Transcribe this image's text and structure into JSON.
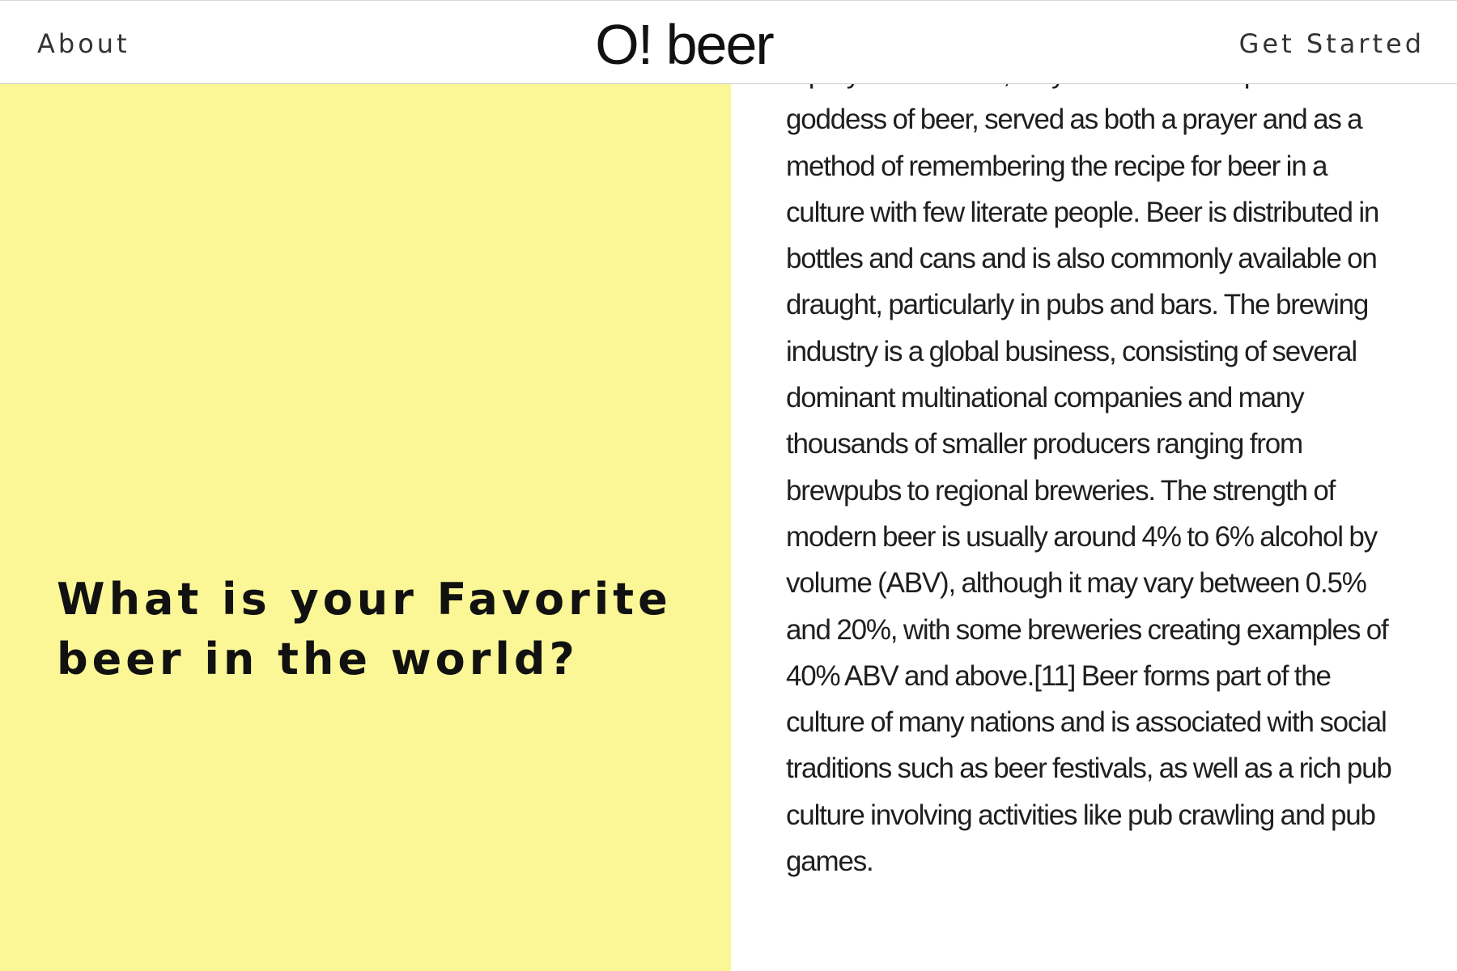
{
  "header": {
    "about_label": "About",
    "logo_text": "O! beer",
    "get_started_label": "Get Started"
  },
  "hero": {
    "headline_line1": "What is your Favorite",
    "headline_line2": "beer in the world?"
  },
  "article": {
    "body": "A prayer to Ninkasi, a hymn to the Mesopotamian goddess of beer, served as both a prayer and as a method of remembering the recipe for beer in a culture with few literate people. Beer is distributed in bottles and cans and is also commonly available on draught, particularly in pubs and bars. The brewing industry is a global business, consisting of several dominant multinational companies and many thousands of smaller producers ranging from brewpubs to regional breweries. The strength of modern beer is usually around 4% to 6% alcohol by volume (ABV), although it may vary between 0.5% and 20%, with some breweries creating examples of 40% ABV and above.[11] Beer forms part of the culture of many nations and is associated with social traditions such as beer festivals, as well as a rich pub culture involving activities like pub crawling and pub games."
  },
  "colors": {
    "left_panel_bg": "#fbf797",
    "text": "#111111"
  }
}
